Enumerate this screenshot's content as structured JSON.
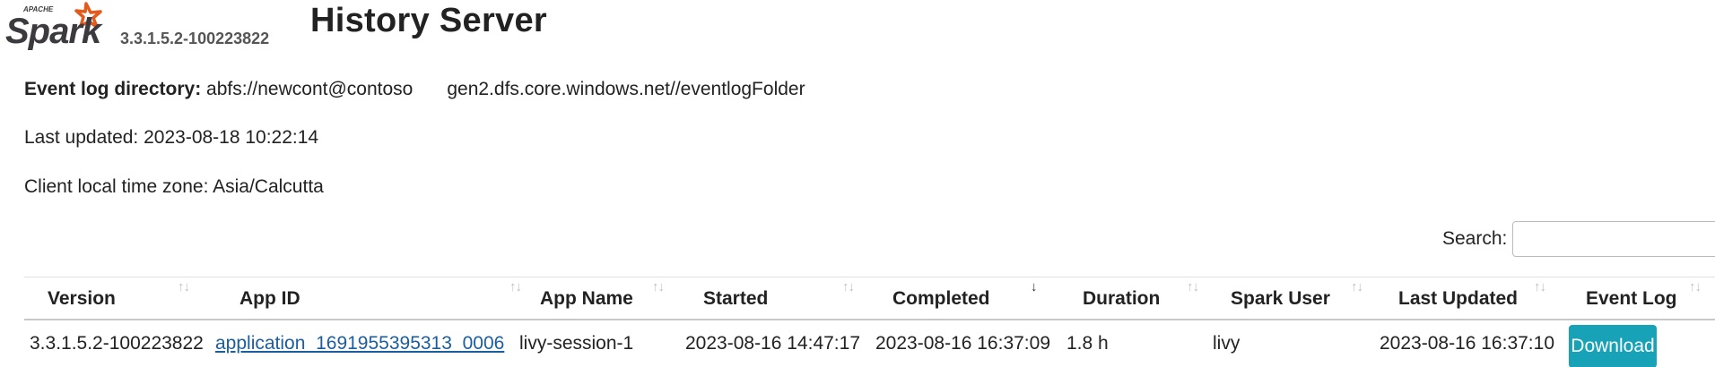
{
  "header": {
    "logo_small_text": "APACHE",
    "logo_text": "Spark",
    "version": "3.3.1.5.2-100223822",
    "title": "History Server"
  },
  "info": {
    "event_log_label": "Event log directory:",
    "event_log_value_1": "abfs://newcont@contoso",
    "event_log_value_2": "gen2.dfs.core.windows.net//eventlogFolder",
    "last_updated": "Last updated: 2023-08-18 10:22:14",
    "time_zone": "Client local time zone: Asia/Calcutta"
  },
  "search": {
    "label": "Search:",
    "value": ""
  },
  "table": {
    "columns": [
      "Version",
      "App ID",
      "App Name",
      "Started",
      "Completed",
      "Duration",
      "Spark User",
      "Last Updated",
      "Event Log"
    ],
    "sort_icon": "↑↓",
    "active_sort_icon": "↓",
    "rows": [
      {
        "version": "3.3.1.5.2-100223822",
        "app_id": "application_1691955395313_0006",
        "app_name": "livy-session-1",
        "started": "2023-08-16 14:47:17",
        "completed": "2023-08-16 16:37:09",
        "duration": "1.8 h",
        "spark_user": "livy",
        "last_updated": "2023-08-16 16:37:10",
        "event_log": "Download"
      }
    ]
  },
  "colors": {
    "accent": "#17a2b8",
    "link": "#1b5e9e",
    "logo_orange": "#e25a1c",
    "logo_text": "#3c3a3e"
  }
}
